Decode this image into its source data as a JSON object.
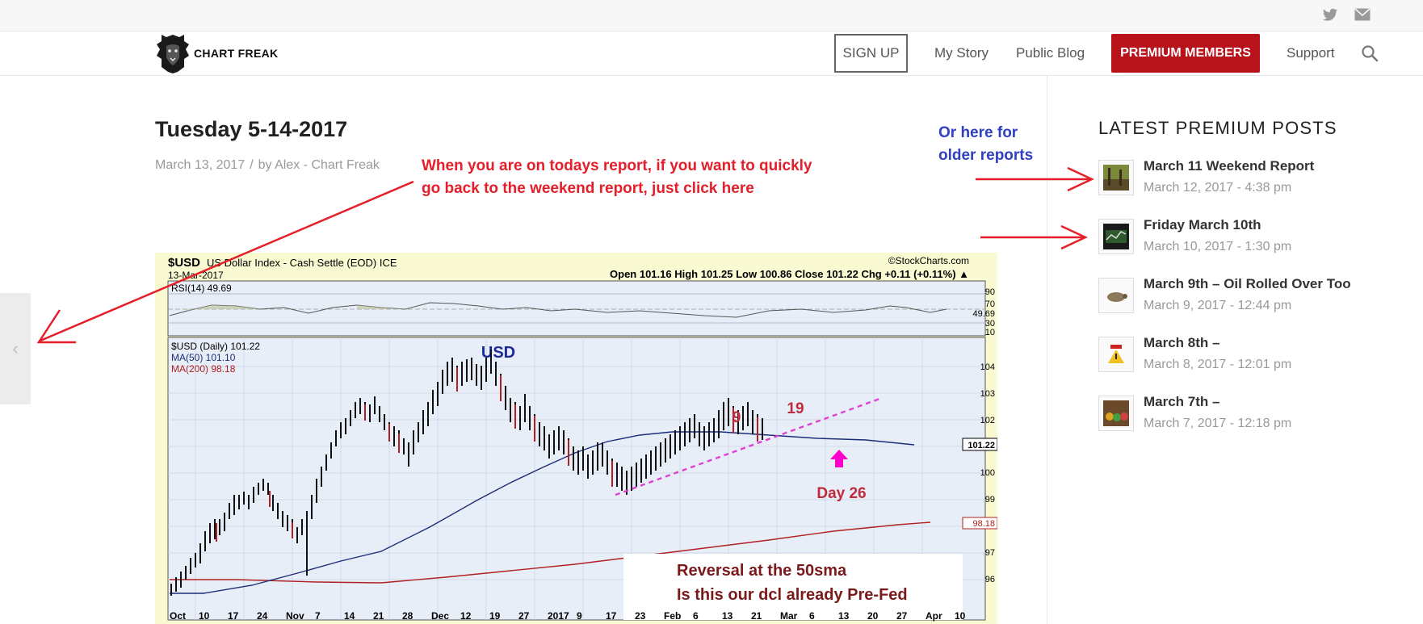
{
  "topbar": {
    "social_icons": [
      "twitter-icon",
      "mail-icon"
    ]
  },
  "header": {
    "logo_text": "CHART FREAK",
    "nav": {
      "signup": "SIGN UP",
      "my_story": "My Story",
      "public_blog": "Public Blog",
      "premium_members": "PREMIUM MEMBERS",
      "support": "Support"
    },
    "colors": {
      "premium_button": "#b8121b"
    }
  },
  "post": {
    "title": "Tuesday 5-14-2017",
    "date": "March 13, 2017",
    "separator": "/",
    "author": "by Alex - Chart Freak"
  },
  "annotations": {
    "red_line1": "When you are on todays report, if you want to quickly",
    "red_line2": "go back to the weekend report, just click here",
    "blue_line1": "Or here for",
    "blue_line2": "older reports"
  },
  "sidebar": {
    "heading": "LATEST PREMIUM POSTS",
    "items": [
      {
        "title": "March 11 Weekend Report",
        "date": "March 12, 2017 - 4:38 pm"
      },
      {
        "title": "Friday March 10th",
        "date": "March 10, 2017 - 1:30 pm"
      },
      {
        "title": "March 9th – Oil Rolled Over Too",
        "date": "March 9, 2017 - 12:44 pm"
      },
      {
        "title": "March 8th –",
        "date": "March 8, 2017 - 12:01 pm"
      },
      {
        "title": "March 7th –",
        "date": "March 7, 2017 - 12:18 pm"
      }
    ]
  },
  "chart": {
    "symbol": "$USD",
    "name": "US Dollar Index - Cash Settle (EOD) ICE",
    "date": "13-Mar-2017",
    "source": "©StockCharts.com",
    "ohlc": "Open 101.16  High 101.25  Low 100.86  Close 101.22  Chg +0.11 (+0.11%) ▲",
    "rsi_label": "RSI(14) 49.69",
    "rsi_ticks": [
      "90",
      "70",
      "49.69",
      "30",
      "10"
    ],
    "usd_label": "USD",
    "legend_price": "$USD (Daily) 101.22",
    "legend_ma50": "MA(50) 101.10",
    "legend_ma200": "MA(200) 98.18",
    "price_ticks": [
      "104",
      "103",
      "102",
      "101.22",
      "100",
      "99",
      "98.18",
      "97",
      "96"
    ],
    "x_ticks": [
      "Oct",
      "10",
      "17",
      "24",
      "Nov",
      "7",
      "14",
      "21",
      "28",
      "Dec",
      "12",
      "19",
      "27",
      "2017",
      "9",
      "17",
      "23",
      "Feb",
      "6",
      "13",
      "21",
      "Mar",
      "6",
      "13",
      "20",
      "27",
      "Apr",
      "10"
    ],
    "count_9": "9",
    "count_19": "19",
    "day_label": "Day 26",
    "note_line1": "Reversal at the 50sma",
    "note_line2": "Is this our dcl already Pre-Fed",
    "colors": {
      "ma50": "#1b2d7a",
      "ma200": "#b02020",
      "trendline": "#e040d0",
      "annotation": "#c02a3a",
      "arrow": "#ff00cc"
    }
  }
}
